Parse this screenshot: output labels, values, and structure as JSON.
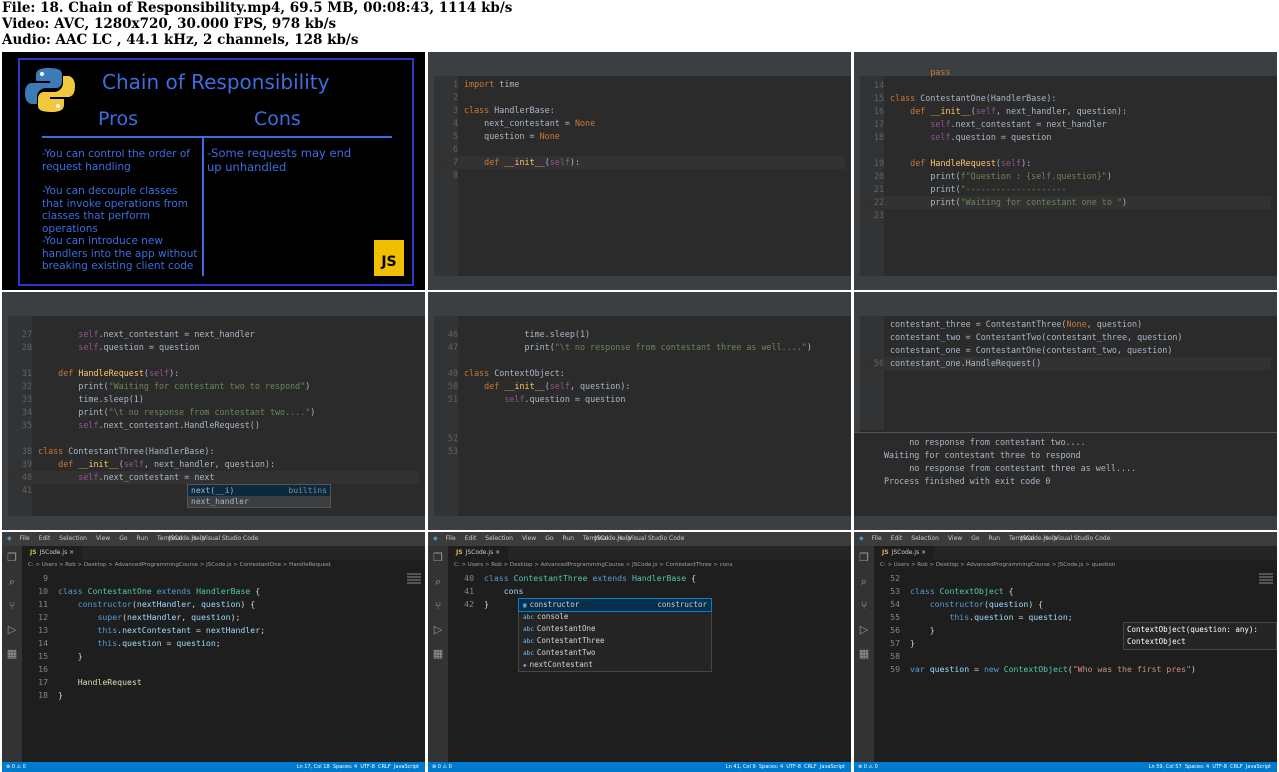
{
  "header": {
    "line1": "File: 18. Chain of Responsibility.mp4, 69.5 MB, 00:08:43, 1114 kb/s",
    "line2": "Video: AVC, 1280x720, 30.000 FPS, 978 kb/s",
    "line3": "Audio: AAC LC , 44.1 kHz, 2 channels, 128 kb/s"
  },
  "slide": {
    "title": "Chain of Responsibility",
    "pros_heading": "Pros",
    "cons_heading": "Cons",
    "pros": [
      "-You can control the order of request handling",
      "-You can decouple classes that invoke operations from classes that perform operations",
      "-You can introduce new handlers into the app without breaking existing client code"
    ],
    "cons": [
      "-Some requests may end up unhandled"
    ],
    "js_badge": "JS",
    "brand_colors": {
      "accent": "#3d6de0",
      "border": "#2b37c8",
      "js": "#f0c000"
    }
  },
  "py1": {
    "lines": [
      {
        "n": "1",
        "t": "import time"
      },
      {
        "n": "2",
        "t": ""
      },
      {
        "n": "3",
        "t": "class HandlerBase:"
      },
      {
        "n": "4",
        "t": "    next_contestant = None"
      },
      {
        "n": "5",
        "t": "    question = None"
      },
      {
        "n": "6",
        "t": ""
      },
      {
        "n": "7",
        "t": "    def __init__(self):"
      },
      {
        "n": "8",
        "t": ""
      }
    ]
  },
  "py2": {
    "lines": [
      {
        "n": "",
        "t": "        pass"
      },
      {
        "n": "14",
        "t": ""
      },
      {
        "n": "15",
        "t": "class ContestantOne(HandlerBase):"
      },
      {
        "n": "16",
        "t": "    def __init__(self, next_handler, question):"
      },
      {
        "n": "17",
        "t": "        self.next_contestant = next_handler"
      },
      {
        "n": "18",
        "t": "        self.question = question"
      },
      {
        "n": "",
        "t": ""
      },
      {
        "n": "19",
        "t": "    def HandleRequest(self):"
      },
      {
        "n": "20",
        "t": "        print(f\"Question : {self.question}\")"
      },
      {
        "n": "21",
        "t": "        print(\"--------------------"
      },
      {
        "n": "22",
        "t": "        print(\"Waiting for contestant one to \")"
      },
      {
        "n": "23",
        "t": ""
      }
    ]
  },
  "py3": {
    "lines": [
      {
        "n": "27",
        "t": "        self.next_contestant = next_handler"
      },
      {
        "n": "28",
        "t": "        self.question = question"
      },
      {
        "n": "",
        "t": ""
      },
      {
        "n": "31",
        "t": "    def HandleRequest(self):"
      },
      {
        "n": "32",
        "t": "        print(\"Waiting for contestant two to respond\")"
      },
      {
        "n": "33",
        "t": "        time.sleep(1)"
      },
      {
        "n": "34",
        "t": "        print(\"\\t no response from contestant two....\")"
      },
      {
        "n": "35",
        "t": "        self.next_contestant.HandleRequest()"
      },
      {
        "n": "",
        "t": ""
      },
      {
        "n": "38",
        "t": "class ContestantThree(HandlerBase):"
      },
      {
        "n": "39",
        "t": "    def __init__(self, next_handler, question):"
      },
      {
        "n": "40",
        "t": "        self.next_contestant = next"
      },
      {
        "n": "41",
        "t": ""
      }
    ],
    "popup": [
      {
        "label": "next(__i)",
        "hint": "builtins"
      },
      {
        "label": "next_handler",
        "hint": ""
      }
    ]
  },
  "py4": {
    "lines": [
      {
        "n": "46",
        "t": "            time.sleep(1)"
      },
      {
        "n": "47",
        "t": "            print(\"\\t no response from contestant three as well....\")"
      },
      {
        "n": "",
        "t": ""
      },
      {
        "n": "49",
        "t": "class ContextObject:"
      },
      {
        "n": "50",
        "t": "    def __init__(self, question):"
      },
      {
        "n": "51",
        "t": "        self.question = question"
      },
      {
        "n": "",
        "t": ""
      },
      {
        "n": "",
        "t": ""
      },
      {
        "n": "52",
        "t": ""
      },
      {
        "n": "53",
        "t": ""
      }
    ]
  },
  "py5": {
    "lines": [
      {
        "n": "",
        "t": "contestant_three = ContestantThree(None, question)"
      },
      {
        "n": "",
        "t": "contestant_two = ContestantTwo(contestant_three, question)"
      },
      {
        "n": "",
        "t": "contestant_one = ContestantOne(contestant_two, question)"
      },
      {
        "n": "56",
        "t": "contestant_one.HandleRequest()"
      }
    ],
    "output": [
      "     no response from contestant two....",
      "Waiting for contestant three to respond",
      "     no response from contestant three as well....",
      "",
      "Process finished with exit code 0"
    ]
  },
  "vs": {
    "menu": [
      "File",
      "Edit",
      "Selection",
      "View",
      "Go",
      "Run",
      "Terminal",
      "Help"
    ],
    "window_title": "JSCode.js - Visual Studio Code",
    "tab": "JSCode.js",
    "status_lang": "JavaScript",
    "status_enc": "UTF-8",
    "status_eol": "CRLF",
    "status_spaces": "Spaces: 4",
    "errors": "0",
    "warnings": "0"
  },
  "vs1": {
    "crumb": "C: > Users > Rob > Desktop > AdvancedProgrammingCourse > JSCode.js > ContestantOne > HandleRequest",
    "lines": [
      {
        "n": "9",
        "t": ""
      },
      {
        "n": "10",
        "t": "class ContestantOne extends HandlerBase {"
      },
      {
        "n": "11",
        "t": "    constructor(nextHandler, question) {"
      },
      {
        "n": "12",
        "t": "        super(nextHandler, question);"
      },
      {
        "n": "13",
        "t": "        this.nextContestant = nextHandler;"
      },
      {
        "n": "14",
        "t": "        this.question = question;"
      },
      {
        "n": "15",
        "t": "    }"
      },
      {
        "n": "16",
        "t": ""
      },
      {
        "n": "17",
        "t": "    HandleRequest"
      },
      {
        "n": "18",
        "t": "}"
      }
    ],
    "status_pos": "Ln 17, Col 18"
  },
  "vs2": {
    "crumb": "C: > Users > Rob > Desktop > AdvancedProgrammingCourse > JSCode.js > ContestantThree > cons",
    "lines": [
      {
        "n": "40",
        "t": "class ContestantThree extends HandlerBase {"
      },
      {
        "n": "41",
        "t": "    cons"
      },
      {
        "n": "42",
        "t": "}"
      }
    ],
    "suggestions": [
      "constructor",
      "console",
      "ContestantOne",
      "ContestantThree",
      "ContestantTwo",
      "nextContestant"
    ],
    "suggest_detail": "constructor",
    "status_pos": "Ln 41, Col 9"
  },
  "vs3": {
    "crumb": "C: > Users > Rob > Desktop > AdvancedProgrammingCourse > JSCode.js > question",
    "lines": [
      {
        "n": "52",
        "t": ""
      },
      {
        "n": "53",
        "t": "class ContextObject {"
      },
      {
        "n": "54",
        "t": "    constructor(question) {"
      },
      {
        "n": "55",
        "t": "        this.question = question;"
      },
      {
        "n": "56",
        "t": "    }"
      },
      {
        "n": "57",
        "t": "}"
      },
      {
        "n": "58",
        "t": ""
      },
      {
        "n": "59",
        "t": "var question = new ContextObject(\"Who was the first pres\")"
      }
    ],
    "hint1": "ContextObject(question: any):",
    "hint2": "ContextObject",
    "status_pos": "Ln 59, Col 57"
  }
}
